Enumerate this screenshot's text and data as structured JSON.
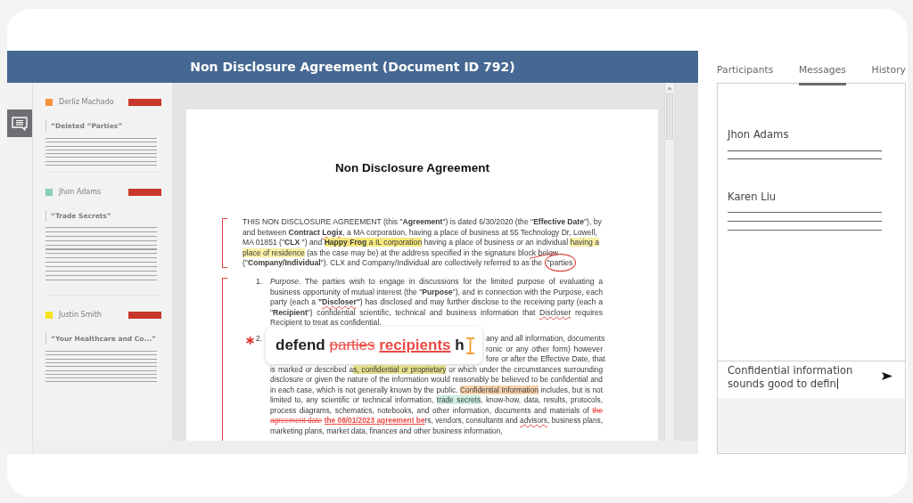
{
  "header": {
    "title": "Non Disclosure Agreement (Document ID 792)"
  },
  "comments": [
    {
      "author": "Derliz Machado",
      "color": "#f6923a",
      "quote": "“Deleted “Parties”"
    },
    {
      "author": "Jhon Adams",
      "color": "#86d1b8",
      "quote": "“Trade Secrets”"
    },
    {
      "author": "Justin Smith",
      "color": "#f9e21a",
      "quote": "“Your Healthcare and Co...”"
    }
  ],
  "document": {
    "title": "Non Disclosure Agreement",
    "sections": [
      {
        "continues": false,
        "paragraphs": [
          {
            "flagged": false,
            "runs": [
              {
                "kind": "plain",
                "text": "THIS NON DISCLOSURE AGREEMENT (this \"**Agreement**\") is dated 6/30/2020 (the \"**Effective Date**\"), by and between **Contract** "
              },
              {
                "kind": "misspelled",
                "text": "**Logix**"
              },
              {
                "kind": "plain",
                "text": ", a MA corporation, having a place of business at 55 Technology Dr, Lowell, MA 01851 (\"**CLX** \") and "
              },
              {
                "kind": "highlight",
                "color": "#f7ea7e",
                "text": "**Happy Frog** a IL corporation"
              },
              {
                "kind": "plain",
                "text": " having a place of business or an individual "
              },
              {
                "kind": "highlight",
                "color": "#f9f0a6",
                "text": "having a place of residence"
              },
              {
                "kind": "plain",
                "text": " (as the case may be) at the address specified in the signature block below (\"**Company/Individual**\"). CLX and Company/Individual are collectively referred to as the "
              },
              {
                "kind": "circled",
                "text": "\"parties"
              }
            ]
          }
        ]
      },
      {
        "continues": true,
        "paragraphs": [
          {
            "flagged": false,
            "number": "1.",
            "runs": [
              {
                "kind": "plain",
                "text": "*Purpose*. The parties wish to engage in discussions for the limited purpose of evaluating a business opportunity of mutual interest (the \"**Purpose**\"), and in connection with the Purpose, each party (each a **\"**"
              },
              {
                "kind": "misspelled",
                "text": "**Discloser**"
              },
              {
                "kind": "plain",
                "text": "**\"**) has disclosed and may further disclose to the receiving party (each a \"**Recipient**\") confidential scientific, technical and business information that "
              },
              {
                "kind": "misspelled",
                "text": "Discloser"
              },
              {
                "kind": "plain",
                "text": " requires Recipient to treat as confidential."
              }
            ]
          },
          {
            "flagged": true,
            "number": "2.",
            "suggestion": {
              "runs": [
                {
                  "kind": "plain",
                  "text": "defend "
                },
                {
                  "kind": "deleted",
                  "text": "parties"
                },
                {
                  "kind": "inserted",
                  "text": " recipients"
                },
                {
                  "kind": "plain",
                  "text": " h"
                }
              ]
            },
            "partial_lines": [
              "any and all information, documents",
              "ronic or any other form) however",
              "fore or after the Effective Date, that"
            ],
            "runs": [
              {
                "kind": "plain",
                "text": "is marked or described a"
              },
              {
                "kind": "highlight",
                "color": "#e4de8c",
                "text": "s, confidential or proprietary"
              },
              {
                "kind": "plain",
                "text": " or which under the circumstances surrounding disclosure or given the nature of the information would reasonably be believed to be confidential and in each case, which is not generally known by the public. "
              },
              {
                "kind": "highlight",
                "color": "#f8d3ad",
                "text": "Confidential Information"
              },
              {
                "kind": "plain",
                "text": " includes, but is not limited to, any scientific or technical information, "
              },
              {
                "kind": "highlight",
                "color": "#cdeee1",
                "text": "trade secrets"
              },
              {
                "kind": "plain",
                "text": ", know-how, data, results, protocols, process diagrams, schematics, notebooks, and other information, documents and materials of "
              },
              {
                "kind": "deleted",
                "text": "the agreement date"
              },
              {
                "kind": "inserted",
                "text": " the 08/01/2023 agreement be"
              },
              {
                "kind": "plain",
                "text": "rs, vendors, consultants and "
              },
              {
                "kind": "misspelled",
                "text": "advisors"
              },
              {
                "kind": "plain",
                "text": ", business plans, marketing plans, market data, finances and other business information,"
              }
            ]
          }
        ]
      }
    ]
  },
  "tabs": [
    {
      "label": "Participants",
      "selected": false
    },
    {
      "label": "Messages",
      "selected": true
    },
    {
      "label": "History",
      "selected": false
    }
  ],
  "messages": [
    {
      "author": "Jhon Adams"
    },
    {
      "author": "Karen Liu"
    }
  ],
  "composer": {
    "value": "Confidential information sounds good to defin"
  }
}
